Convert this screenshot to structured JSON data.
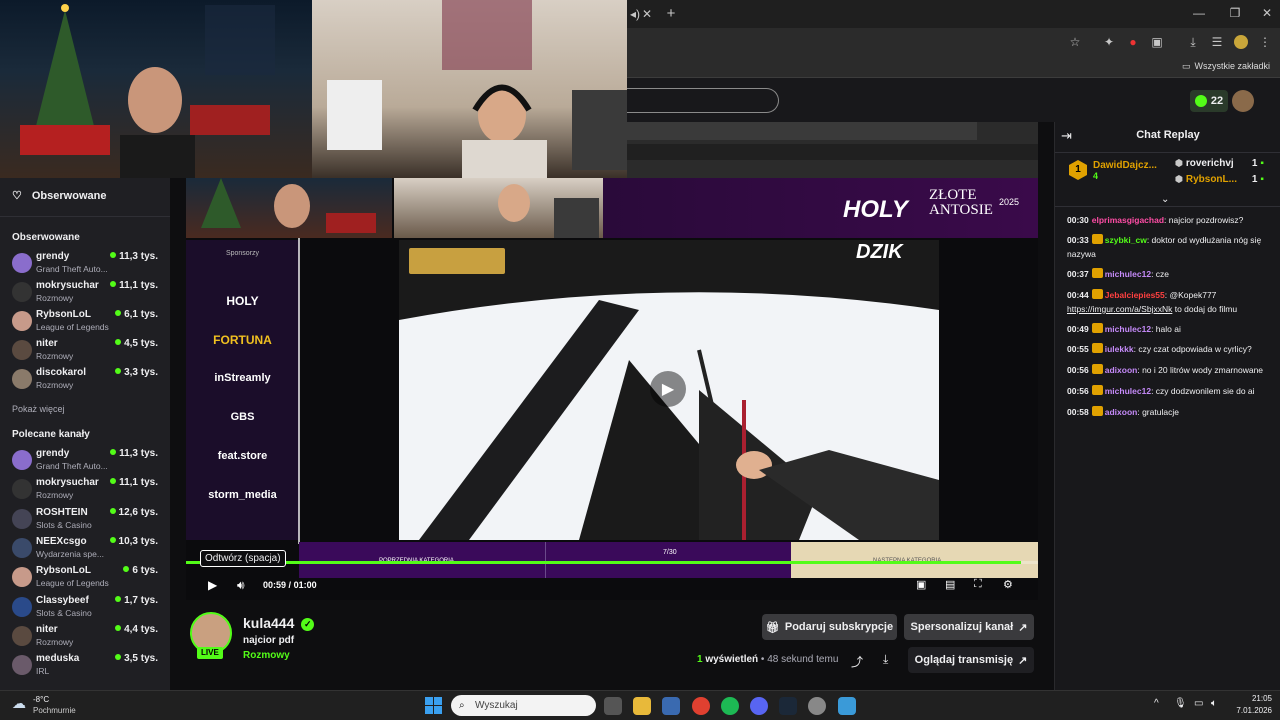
{
  "browser": {
    "bookmarks_label": "Wszystkie zakładki",
    "kick_count": "22"
  },
  "sidebar": {
    "followed_header": "Obserwowane",
    "followed_section": "Obserwowane",
    "followed": [
      {
        "name": "grendy",
        "category": "Grand Theft Auto...",
        "viewers": "11,3 tys.",
        "color": "#8a6dcc"
      },
      {
        "name": "mokrysuchar",
        "category": "Rozmowy",
        "viewers": "11,1 tys.",
        "color": "#333333"
      },
      {
        "name": "RybsonLoL",
        "category": "League of Legends",
        "viewers": "6,1 tys.",
        "color": "#c79a8a"
      },
      {
        "name": "niter",
        "category": "Rozmowy",
        "viewers": "4,5 tys.",
        "color": "#5a4a40"
      },
      {
        "name": "discokarol",
        "category": "Rozmowy",
        "viewers": "3,3 tys.",
        "color": "#8a7a6a"
      }
    ],
    "show_more": "Pokaż więcej",
    "recommended_section": "Polecane kanały",
    "recommended": [
      {
        "name": "grendy",
        "category": "Grand Theft Auto...",
        "viewers": "11,3 tys.",
        "color": "#8a6dcc"
      },
      {
        "name": "mokrysuchar",
        "category": "Rozmowy",
        "viewers": "11,1 tys.",
        "color": "#333333"
      },
      {
        "name": "ROSHTEIN",
        "category": "Slots & Casino",
        "viewers": "12,6 tys.",
        "color": "#444455"
      },
      {
        "name": "NEEXcsgo",
        "category": "Wydarzenia spe...",
        "viewers": "10,3 tys.",
        "color": "#3a4a6a"
      },
      {
        "name": "RybsonLoL",
        "category": "League of Legends",
        "viewers": "6 tys.",
        "color": "#c79a8a"
      },
      {
        "name": "Classybeef",
        "category": "Slots & Casino",
        "viewers": "1,7 tys.",
        "color": "#2a4a8a"
      },
      {
        "name": "niter",
        "category": "Rozmowy",
        "viewers": "4,4 tys.",
        "color": "#5a4a40"
      },
      {
        "name": "meduska",
        "category": "IRL",
        "viewers": "3,5 tys.",
        "color": "#6a5a6a"
      }
    ]
  },
  "player": {
    "tooltip": "Odtwórz (spacja)",
    "current_time": "00:59",
    "separator": "/",
    "duration": "01:00",
    "progress": 0.98,
    "sponsors_label": "Sponsorzy",
    "sponsors": [
      "HOLY",
      "FORTUNA",
      "inStreamly",
      "GBS",
      "feat.store",
      "storm_media"
    ],
    "banner_brand": "HOLY",
    "banner_title": "ZŁOTE ANTOSIE",
    "banner_year": "2025",
    "dzik": "DZIK",
    "prev_category": "POPRZEDNIA KATEGORIA",
    "counter": "7/30",
    "next_category": "NASTĘPNA KATEGORIA"
  },
  "channel": {
    "name": "kula444",
    "title": "najcior pdf",
    "category": "Rozmowy",
    "live_label": "LIVE",
    "gift_button": "Podaruj subskrypcje",
    "customize_button": "Spersonalizuj kanał",
    "views_count": "1",
    "views_label": "wyświetleń",
    "time_ago": "48 sekund temu",
    "watch_button": "Oglądaj transmisję"
  },
  "chat": {
    "title": "Chat Replay",
    "leaderboard": [
      {
        "rank": "1",
        "name": "DawidDajcz...",
        "count": "4",
        "color": "#e0a100"
      },
      {
        "rank": "",
        "name": "roverichvj",
        "count": "1",
        "color": "#efeff1"
      },
      {
        "rank": "",
        "name": "RybsonL...",
        "count": "1",
        "color": "#e0a100"
      }
    ],
    "messages": [
      {
        "time": "00:30",
        "user": "elprimasgigachad",
        "user_color": "#ff4da6",
        "text": "najcior pozdrowisz?"
      },
      {
        "time": "00:33",
        "user": "szybki_cw",
        "user_color": "#53fc18",
        "text": "doktor od wydłużania nóg się nazywa"
      },
      {
        "time": "00:37",
        "user": "michulec12",
        "user_color": "#c58af9",
        "text": "cze"
      },
      {
        "time": "00:44",
        "user": "Jebalciepies55",
        "user_color": "#ff4040",
        "text": "@Kopek777",
        "link": "https://imgur.com/a/SbjxxNk",
        "text2": "to dodaj do filmu"
      },
      {
        "time": "00:49",
        "user": "michulec12",
        "user_color": "#c58af9",
        "text": "halo ai"
      },
      {
        "time": "00:55",
        "user": "iulekkk",
        "user_color": "#c58af9",
        "text": "czy czat odpowiada w cyrlicy?"
      },
      {
        "time": "00:56",
        "user": "adixoon",
        "user_color": "#c58af9",
        "text": "no i 20 litrów wody zmarnowane"
      },
      {
        "time": "00:56",
        "user": "michulec12",
        "user_color": "#c58af9",
        "text": "czy dodzwonilem sie do ai"
      },
      {
        "time": "00:58",
        "user": "adixoon",
        "user_color": "#c58af9",
        "text": "gratulacje"
      }
    ]
  },
  "taskbar": {
    "weather_temp": "-8°C",
    "weather_desc": "Pochmurnie",
    "search_placeholder": "Wyszukaj",
    "time": "21:05",
    "date": "7.01.2026"
  }
}
